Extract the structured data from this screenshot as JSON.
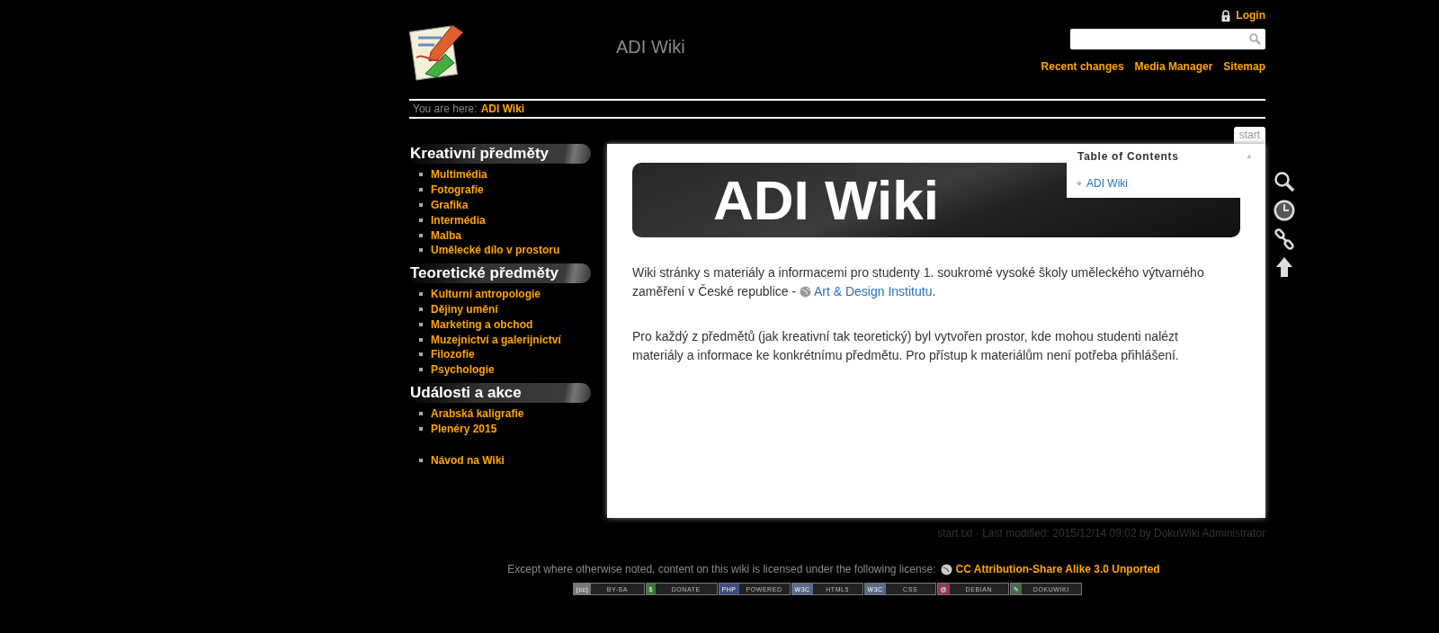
{
  "header": {
    "site_title": "ADI Wiki",
    "login": "Login",
    "links": [
      "Recent changes",
      "Media Manager",
      "Sitemap"
    ]
  },
  "breadcrumb": {
    "label": "You are here:",
    "current": "ADI Wiki"
  },
  "sidebar": [
    {
      "heading": "Kreativní předměty",
      "items": [
        "Multimédia",
        "Fotografie",
        "Grafika",
        "Intermédia",
        "Malba",
        "Umělecké dílo v prostoru"
      ]
    },
    {
      "heading": "Teoretické předměty",
      "items": [
        "Kulturní antropologie",
        "Dějiny umění",
        "Marketing a obchod",
        "Muzejnictví a galerijnictví",
        "Filozofie",
        "Psychologie"
      ]
    },
    {
      "heading": "Události a akce",
      "items": [
        "Arabská kaligrafie",
        "Plenéry 2015"
      ]
    },
    {
      "items": [
        "Návod na Wiki"
      ]
    }
  ],
  "page": {
    "tab": "start",
    "banner_title": "ADI Wiki",
    "toc": {
      "title": "Table of Contents",
      "toggle": "▲",
      "items": [
        "ADI Wiki"
      ]
    },
    "paragraphs": [
      {
        "text": "Wiki stránky s materiály a informacemi pro studenty 1. soukromé vysoké školy uměleckého výtvarného zaměření v České republice - ",
        "link": "Art & Design Institutu",
        "after": "."
      },
      {
        "text": "Pro každý z předmětů (jak kreativní tak teoretický) byl vytvořen prostor, kde mohou studenti nalézt materiály a informace ke konkrétnímu předmětu. Pro přístup k materiálům není potřeba přihlášení."
      }
    ],
    "page_info": "start.txt · Last modified: 2015/12/14 09:02 by DokuWiki Administrator"
  },
  "tools": [
    {
      "kind": "search"
    },
    {
      "kind": "revisions"
    },
    {
      "kind": "backlinks"
    },
    {
      "kind": "top"
    }
  ],
  "footer": {
    "license_text": "Except where otherwise noted, content on this wiki is licensed under the following license:",
    "license_link": "CC Attribution-Share Alike 3.0 Unported",
    "badges": [
      {
        "logo": "(cc)",
        "label": "BY-SA",
        "color": "#777777"
      },
      {
        "logo": "$",
        "label": "DONATE",
        "color": "#3a7a3a"
      },
      {
        "logo": "PHP",
        "label": "POWERED",
        "color": "#3b4f7a"
      },
      {
        "logo": "W3C",
        "label": "HTML5",
        "color": "#5a6a8a"
      },
      {
        "logo": "W3C",
        "label": "CSS",
        "color": "#5a6a8a"
      },
      {
        "logo": "@",
        "label": "DEBIAN",
        "color": "#8a3a5a"
      },
      {
        "logo": "✎",
        "label": "DOKUWIKI",
        "color": "#4a6a4a"
      }
    ]
  }
}
